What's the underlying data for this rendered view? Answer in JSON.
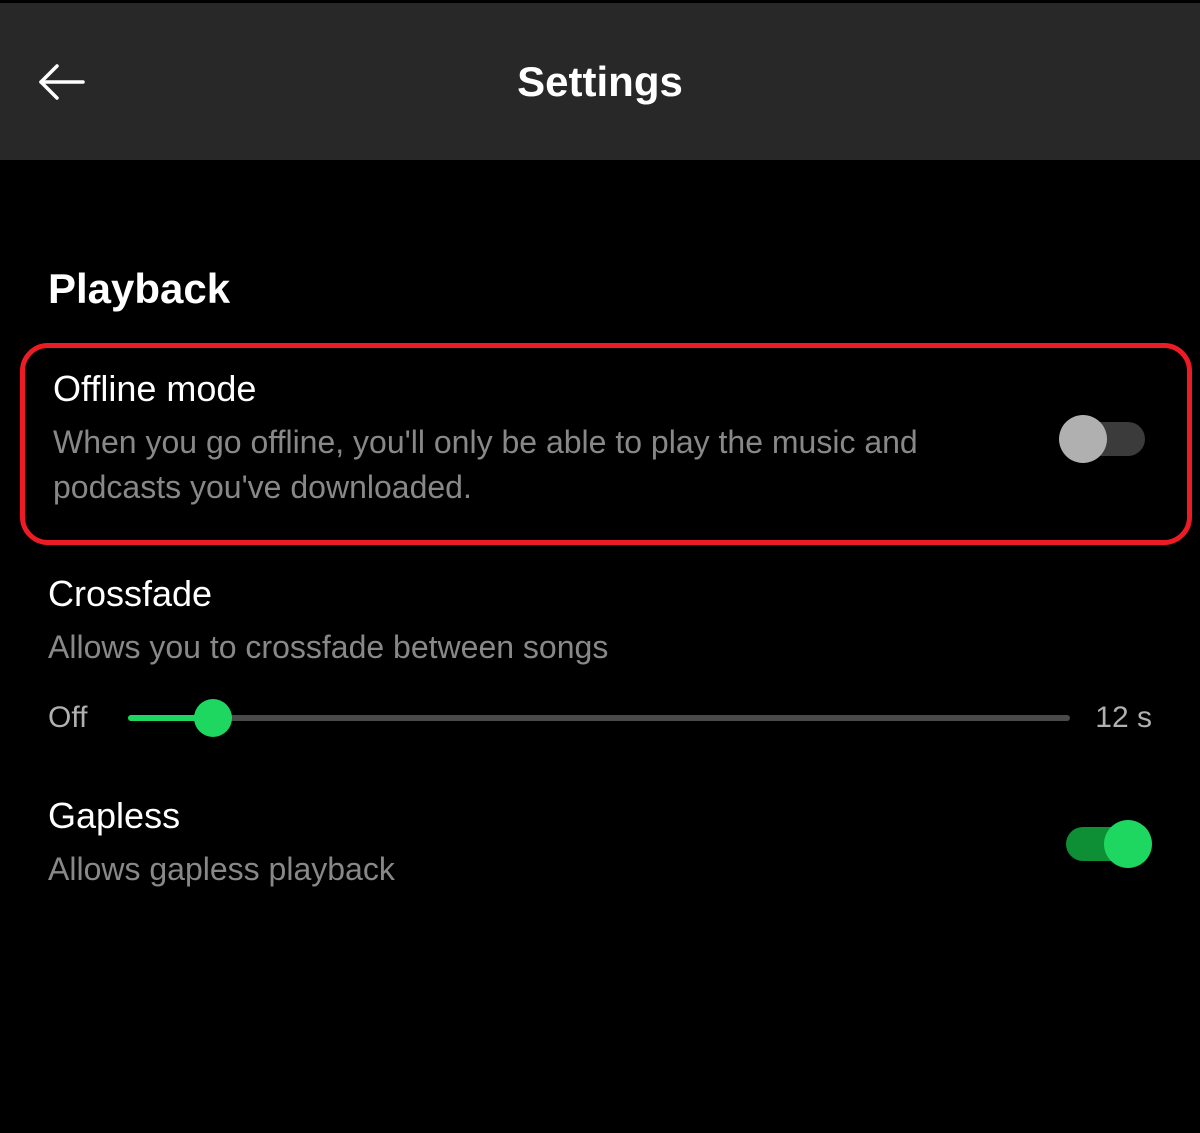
{
  "header": {
    "title": "Settings"
  },
  "section": {
    "title": "Playback"
  },
  "offline": {
    "title": "Offline mode",
    "description": "When you go offline, you'll only be able to play the music and podcasts you've downloaded.",
    "enabled": false
  },
  "crossfade": {
    "title": "Crossfade",
    "description": "Allows you to crossfade between songs",
    "slider_left": "Off",
    "slider_right": "12 s",
    "value_percent": 9
  },
  "gapless": {
    "title": "Gapless",
    "description": "Allows gapless playback",
    "enabled": true
  },
  "colors": {
    "accent": "#1ed760",
    "highlight": "#ed1c24"
  }
}
